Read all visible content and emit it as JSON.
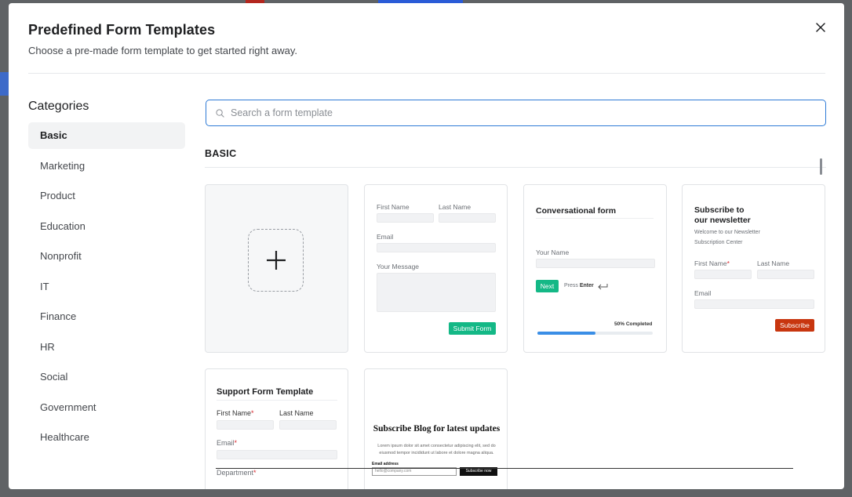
{
  "header": {
    "title": "Predefined Form Templates",
    "subtitle": "Choose a pre-made form template to get started right away."
  },
  "sidebar": {
    "title": "Categories",
    "items": [
      {
        "label": "Basic",
        "active": true
      },
      {
        "label": "Marketing"
      },
      {
        "label": "Product"
      },
      {
        "label": "Education"
      },
      {
        "label": "Nonprofit"
      },
      {
        "label": "IT"
      },
      {
        "label": "Finance"
      },
      {
        "label": "HR"
      },
      {
        "label": "Social"
      },
      {
        "label": "Government"
      },
      {
        "label": "Healthcare"
      }
    ]
  },
  "search": {
    "placeholder": "Search a form template",
    "value": ""
  },
  "section": {
    "label": "BASIC"
  },
  "cards": {
    "contact": {
      "first_name": "First Name",
      "last_name": "Last Name",
      "email": "Email",
      "message": "Your Message",
      "submit": "Submit Form"
    },
    "conversational": {
      "title": "Conversational form",
      "your_name": "Your Name",
      "next": "Next",
      "press": "Press",
      "enter": "Enter",
      "progress_text": "50% Completed",
      "progress": 0.5
    },
    "newsletter": {
      "title_line1": "Subscribe to",
      "title_line2": "our newsletter",
      "welcome": "Welcome to our Newsletter",
      "center": "Subscription Center",
      "first_name": "First Name",
      "last_name": "Last Name",
      "email": "Email",
      "subscribe": "Subscribe"
    },
    "support": {
      "title": "Support Form Template",
      "first_name": "First Name",
      "last_name": "Last Name",
      "email": "Email",
      "department": "Department"
    },
    "blog": {
      "title": "Subscribe Blog for latest updates",
      "body_line1": "Lorem ipsum dolor sit amet consectetur adipiscing elit, sed do",
      "body_line2": "eiusmod tempor incididunt ut labore et dolore magna aliqua.",
      "email_label": "Email address",
      "email_value": "hello@company.com",
      "subscribe": "Subscribe now"
    }
  },
  "colors": {
    "accent": "#2f7bd6",
    "green": "#14b886",
    "red": "#c8360f",
    "progress": "#3a8ee6"
  },
  "icons": {
    "close": "close-icon",
    "search": "search-icon",
    "plus": "plus-icon",
    "enter": "enter-icon"
  }
}
